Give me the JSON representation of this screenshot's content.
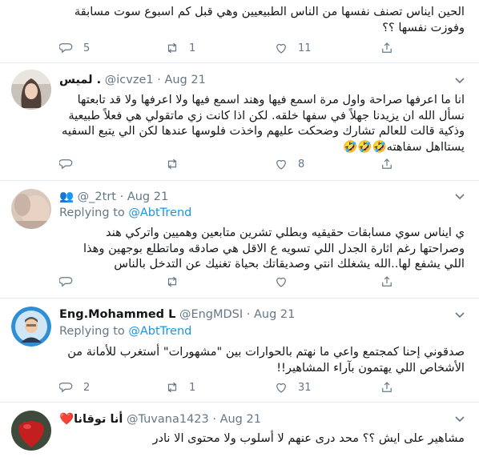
{
  "tweets": [
    {
      "body": "الحين ايناس تصنف نفسها من الناس الطبيعيين وهي قبل كم اسبوع سوت مسابقة وفوزت نفسها ؟؟",
      "counts": {
        "reply": "5",
        "retweet": "1",
        "like": "11"
      }
    },
    {
      "name": "لميس .",
      "handle": "@icvze1",
      "date": "Aug 21",
      "body": "انا ما اعرفها صراحة واول مرة اسمع فيها وهند اسمع فيها ولا اعرفها ولا قد تابعتها نسأل الله ان يزيدنا جهلاً في سفها خلقه. لكن اذا كانت زي ماتقولي هي فعلاً طبيعية وذكية قالت للعالم تشارك وضحكت عليهم واخذت فلوسها عندها لكن الي يتبع السفيه يستااهل سفاهته🤣🤣🤣",
      "counts": {
        "reply": "",
        "retweet": "",
        "like": "8"
      }
    },
    {
      "name": "@_2trt",
      "handle": "",
      "date": "Aug 21",
      "replying": "Replying to",
      "replying_to": "@AbtTrend",
      "body": "ي ايناس سوي مسابقات حقيقيه وبطلي تشرين متابعين وهميين واتركي هند وصراحتها رغم اثارة الجدل اللي تسويه ع الاقل هي صادقه وماتطلع بوجهين وهذا اللي يشفع لها..الله يشغلك انتي وصديقاتك بحياة تغنيك عن التدخل بالناس",
      "counts": {
        "reply": "",
        "retweet": "",
        "like": ""
      }
    },
    {
      "name": "Eng.Mohammed L",
      "handle": "@EngMDSI",
      "date": "Aug 21",
      "replying": "Replying to",
      "replying_to": "@AbtTrend",
      "body": "صدقوني إحنا كمجتمع واعي ما نهتم بالحوارات بين \"مشهورات\" أستغرب للأمانة من الأشخاص اللي يهتمون بآراء المشاهير!!",
      "counts": {
        "reply": "2",
        "retweet": "1",
        "like": "31"
      }
    },
    {
      "name": "❤️أنا توقانا",
      "handle": "@Tuvana1423",
      "date": "Aug 21",
      "body": "مشاهير على ايش ؟؟ محد درى عنهم لا أسلوب ولا محتوى الا نادر"
    }
  ],
  "colors": {
    "text": "#14171a",
    "secondary": "#657786",
    "link": "#1b95e0",
    "border": "#e6ecf0"
  }
}
